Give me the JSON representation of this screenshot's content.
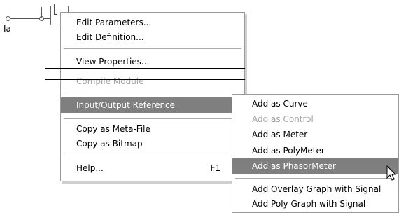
{
  "diagram": {
    "signal_label": "Ia"
  },
  "context_menu": {
    "items": [
      {
        "label": "Edit Parameters...",
        "enabled": true
      },
      {
        "label": "Edit Definition...",
        "enabled": true
      },
      {
        "label": "View Properties...",
        "enabled": true
      },
      {
        "label": "Compile Module",
        "enabled": false
      },
      {
        "label": "Input/Output Reference",
        "enabled": true,
        "highlighted": true,
        "has_submenu": true
      },
      {
        "label": "Copy as Meta-File",
        "enabled": true
      },
      {
        "label": "Copy as Bitmap",
        "enabled": true
      },
      {
        "label": "Help...",
        "enabled": true,
        "shortcut": "F1"
      }
    ]
  },
  "submenu": {
    "items": [
      {
        "label": "Add as Curve",
        "enabled": true
      },
      {
        "label": "Add as Control",
        "enabled": false
      },
      {
        "label": "Add as Meter",
        "enabled": true
      },
      {
        "label": "Add as PolyMeter",
        "enabled": true
      },
      {
        "label": "Add as PhasorMeter",
        "enabled": true,
        "highlighted": true
      },
      {
        "label": "Add Overlay Graph with Signal",
        "enabled": true
      },
      {
        "label": "Add Poly Graph with Signal",
        "enabled": true
      }
    ]
  },
  "colors": {
    "highlight_bg": "#7f7f7f",
    "disabled_text": "#a3a3a3",
    "menu_border": "#9a9a9a"
  }
}
